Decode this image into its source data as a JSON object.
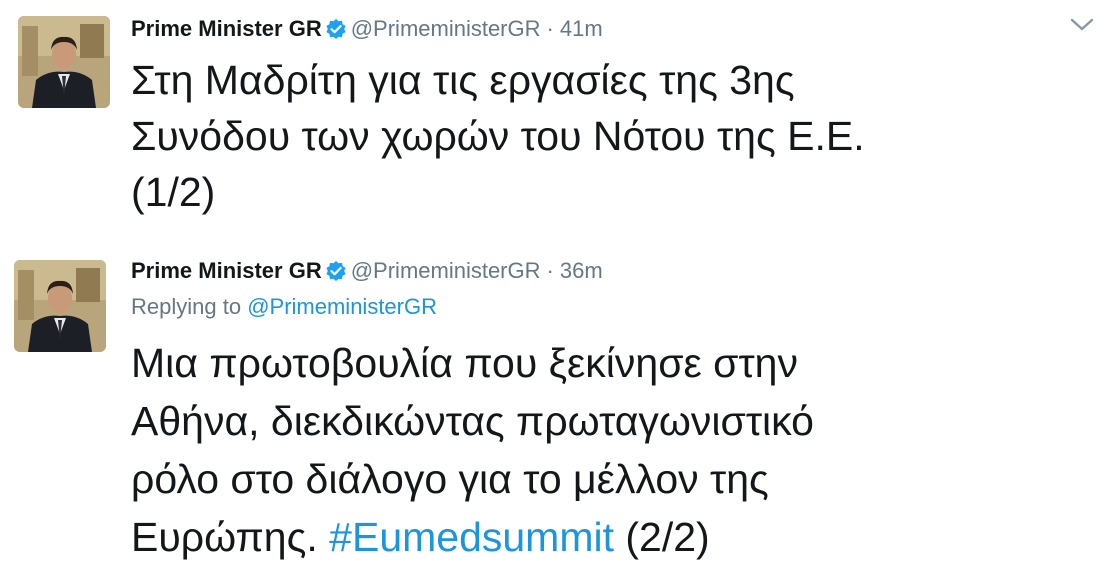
{
  "tweets": [
    {
      "author_name": "Prime Minister GR",
      "handle": "@PrimeministerGR",
      "separator": "·",
      "time": "41m",
      "text_lines": [
        "Στη Μαδρίτη για τις εργασίες της 3ης",
        "Συνόδου των χωρών του Νότου της Ε.Ε.",
        "(1/2)"
      ]
    },
    {
      "author_name": "Prime Minister GR",
      "handle": "@PrimeministerGR",
      "separator": "·",
      "time": "36m",
      "replying_label": "Replying to",
      "replying_to": "@PrimeministerGR",
      "text_lines": [
        "Μια πρωτοβουλία που ξεκίνησε στην",
        "Αθήνα, διεκδικώντας πρωταγωνιστικό",
        "ρόλο στο διάλογο για το μέλλον της"
      ],
      "last_line_prefix": "Ευρώπης.",
      "hashtag": "#Eumedsummit",
      "last_line_suffix": "(2/2)"
    }
  ],
  "icons": {
    "verified": "verified-badge-icon",
    "more": "chevron-down-icon"
  },
  "colors": {
    "link": "#1b95e0",
    "secondary_text": "#657786",
    "primary_text": "#14171a"
  }
}
